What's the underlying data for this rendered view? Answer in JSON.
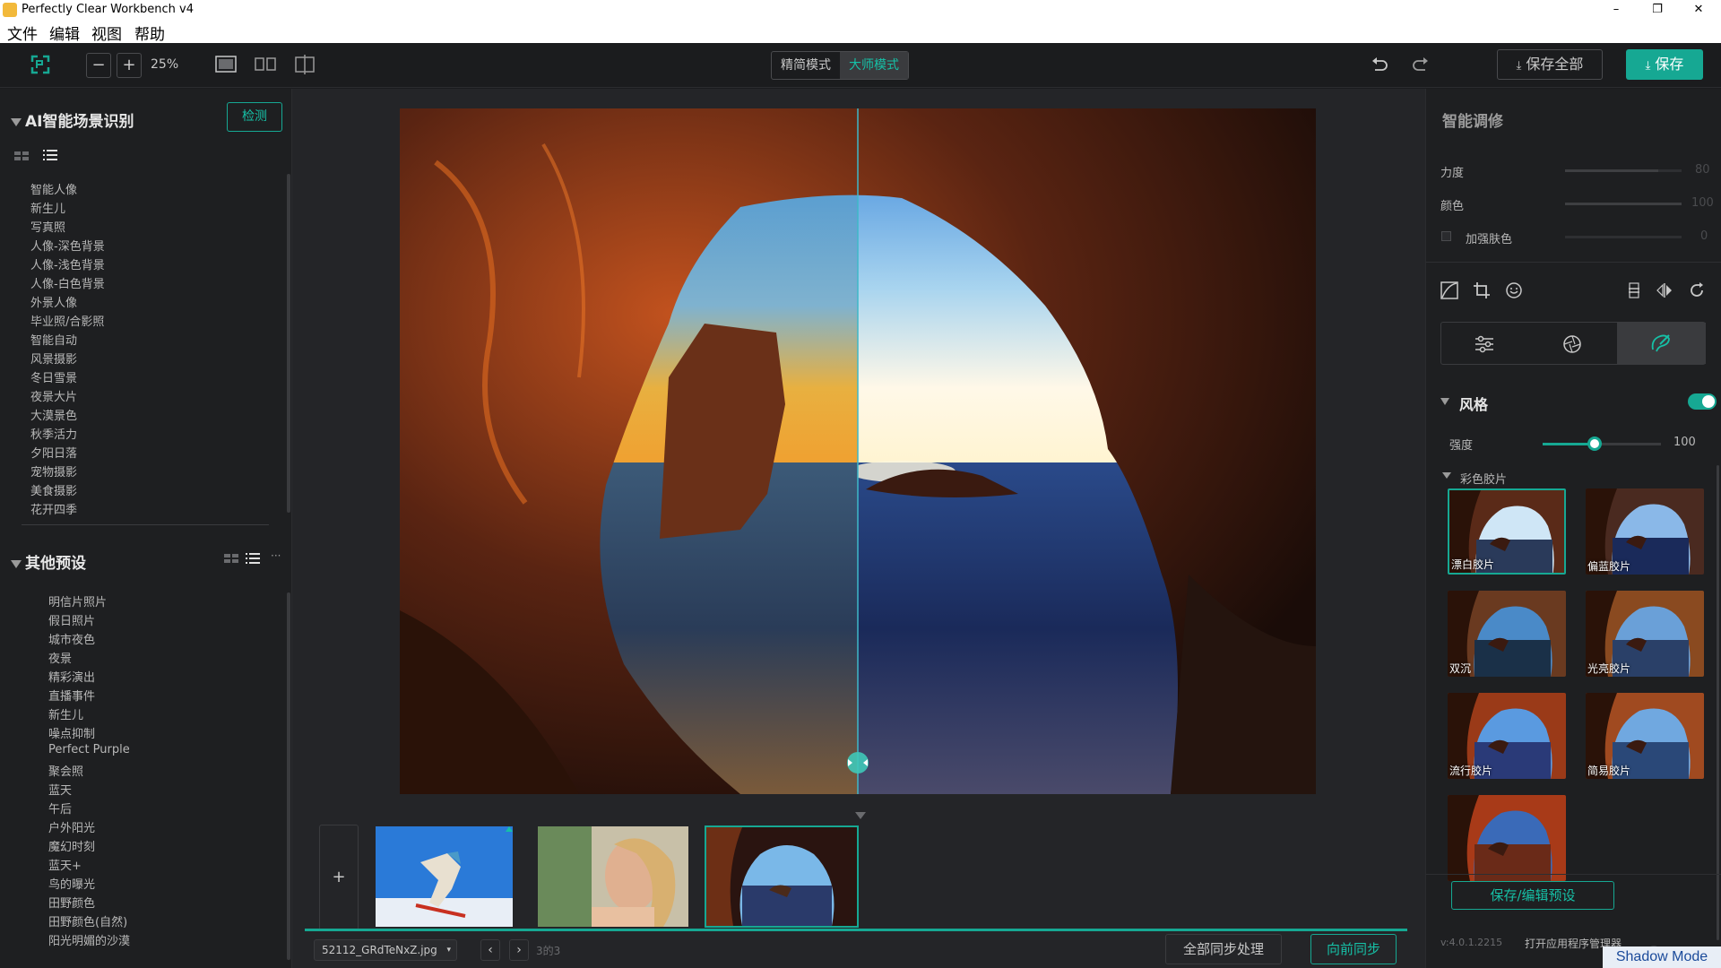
{
  "window": {
    "title": "Perfectly Clear Workbench v4",
    "minimize": "–",
    "maximize": "❐",
    "close": "✕"
  },
  "menu": [
    "文件",
    "编辑",
    "视图",
    "帮助"
  ],
  "toolbar": {
    "zoom_out": "−",
    "zoom_in": "+",
    "zoom_level": "25%",
    "mode_simple": "精简模式",
    "mode_master": "大师模式",
    "save_all": "保存全部",
    "save": "保存"
  },
  "left_panel": {
    "ai_section_title": "AI智能场景识别",
    "detect_button": "检测",
    "ai_items": [
      "智能人像",
      "新生儿",
      "写真照",
      "人像-深色背景",
      "人像-浅色背景",
      "人像-白色背景",
      "外景人像",
      "毕业照/合影照",
      "智能自动",
      "风景摄影",
      "冬日雪景",
      "夜景大片",
      "大漠景色",
      "秋季活力",
      "夕阳日落",
      "宠物摄影",
      "美食摄影",
      "花开四季"
    ],
    "presets_title": "其他预设",
    "preset_more": "···",
    "preset_items": [
      "明信片照片",
      "假日照片",
      "城市夜色",
      "夜景",
      "精彩演出",
      "直播事件",
      "新生儿",
      "噪点抑制",
      "Perfect Purple",
      "聚会照",
      "蓝天",
      "午后",
      "户外阳光",
      "魔幻时刻",
      "蓝天+",
      "鸟的曝光",
      "田野颜色",
      "田野颜色(自然)",
      "阳光明媚的沙漠"
    ]
  },
  "bottom": {
    "add": "+",
    "filename": "52112_GRdTeNxZ.jpg",
    "prev": "‹",
    "next": "›",
    "counter": "3的3",
    "sync_all": "全部同步处理",
    "sync_forward": "向前同步"
  },
  "right_panel": {
    "smart_title": "智能调修",
    "strength_label": "力度",
    "strength_value": "80",
    "color_label": "颜色",
    "color_value": "100",
    "skin_label": "加强肤色",
    "skin_value": "0",
    "style_title": "风格",
    "intensity_label": "强度",
    "intensity_value": "100",
    "film_group": "彩色胶片",
    "films": [
      "漂白胶片",
      "偏蓝胶片",
      "双沉",
      "光亮胶片",
      "流行胶片",
      "简易胶片",
      ""
    ],
    "save_preset": "保存/编辑预设",
    "version": "v:4.0.1.2215",
    "open_manager": "打开应用程序管理器",
    "shadow_mode": "Shadow Mode",
    "help": "?"
  },
  "colors": {
    "accent": "#16a893",
    "bg": "#1b1c1e",
    "panel": "#1e1f21"
  }
}
